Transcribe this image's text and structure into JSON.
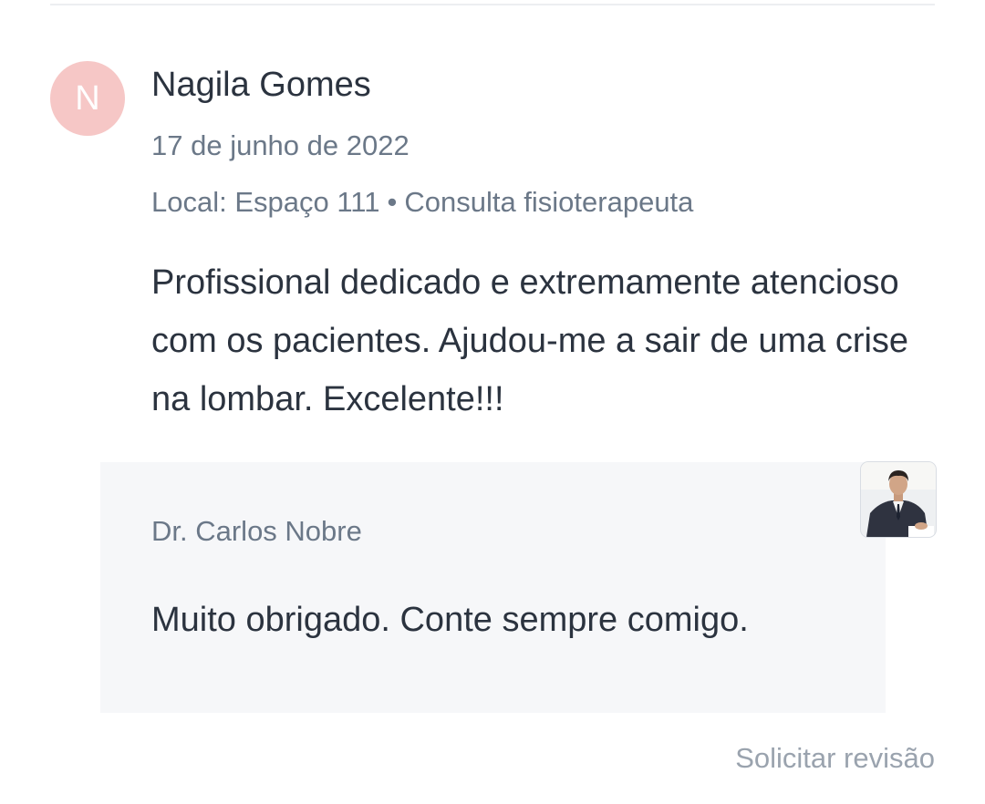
{
  "review": {
    "avatar_initial": "N",
    "reviewer_name": "Nagila Gomes",
    "date": "17 de junho de 2022",
    "location": "Local: Espaço 111",
    "separator": "•",
    "service": "Consulta fisioterapeuta",
    "text": "Profissional dedicado e extremamente atencioso com os pacientes. Ajudou-me a sair de uma crise na lombar. Excelente!!!"
  },
  "reply": {
    "author": "Dr. Carlos Nobre",
    "text": "Muito obrigado. Conte sempre comigo.",
    "photo_icon": "doctor-photo"
  },
  "actions": {
    "request_review_label": "Solicitar revisão"
  },
  "colors": {
    "avatar_bg": "#f6c7c6",
    "reply_bg": "#f6f7f9",
    "primary_text": "#2b333f",
    "secondary_text": "#6b7888",
    "muted_link": "#9aa3ae"
  }
}
